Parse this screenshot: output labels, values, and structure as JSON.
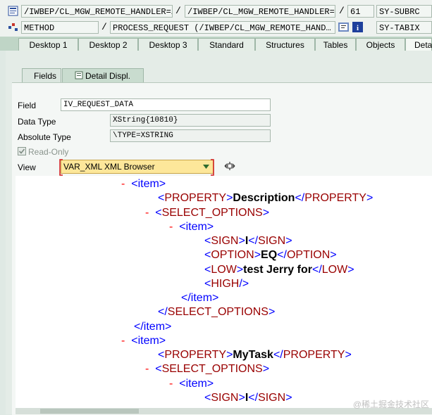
{
  "header": {
    "row1": {
      "program": "/IWBEP/CL_MGW_REMOTE_HANDLER=…",
      "include": "/IWBEP/CL_MGW_REMOTE_HANDLER=…",
      "line": "61",
      "sysvar": "SY-SUBRC",
      "sep1": "/",
      "sep2": "/"
    },
    "row2": {
      "event_type": "METHOD",
      "event": "PROCESS_REQUEST (/IWBEP/CL_MGW_REMOTE_HAND…",
      "sysvar": "SY-TABIX",
      "sep": "/"
    }
  },
  "tabs": [
    "Desktop 1",
    "Desktop 2",
    "Desktop 3",
    "Standard",
    "Structures",
    "Tables",
    "Objects",
    "Deta"
  ],
  "subtabs": [
    "Fields",
    "Detail Displ."
  ],
  "detail": {
    "field_label": "Field",
    "field_value": "IV_REQUEST_DATA",
    "data_type_label": "Data Type",
    "data_type_value": "XString{10810}",
    "abs_type_label": "Absolute Type",
    "abs_type_value": "\\TYPE=XSTRING",
    "readonly_label": "Read-Only",
    "view_label": "View",
    "view_value": "VAR_XML XML Browser"
  },
  "xml": {
    "l1": {
      "minus": "-",
      "open": "<item>"
    },
    "l2": {
      "open": "<PROPERTY>",
      "text": "Description",
      "close": "</PROPERTY>"
    },
    "l3": {
      "minus": "-",
      "open": "<SELECT_OPTIONS>"
    },
    "l4": {
      "minus": "-",
      "open": "<item>"
    },
    "l5": {
      "open": "<SIGN>",
      "text": "I",
      "close": "</SIGN>"
    },
    "l6": {
      "open": "<OPTION>",
      "text": "EQ",
      "close": "</OPTION>"
    },
    "l7": {
      "open": "<LOW>",
      "text": "test Jerry for",
      "close": "</LOW>"
    },
    "l8": {
      "open": "<HIGH/>"
    },
    "l9": {
      "close": "</item>"
    },
    "l10": {
      "close": "</SELECT_OPTIONS>"
    },
    "l11": {
      "close": "</item>"
    },
    "l12": {
      "minus": "-",
      "open": "<item>"
    },
    "l13": {
      "open": "<PROPERTY>",
      "text": "MyTask",
      "close": "</PROPERTY>"
    },
    "l14": {
      "minus": "-",
      "open": "<SELECT_OPTIONS>"
    },
    "l15": {
      "minus": "-",
      "open": "<item>"
    },
    "l16": {
      "open": "<SIGN>",
      "text": "I",
      "close": "</SIGN>"
    }
  },
  "watermark": "@稀土掘金技术社区"
}
